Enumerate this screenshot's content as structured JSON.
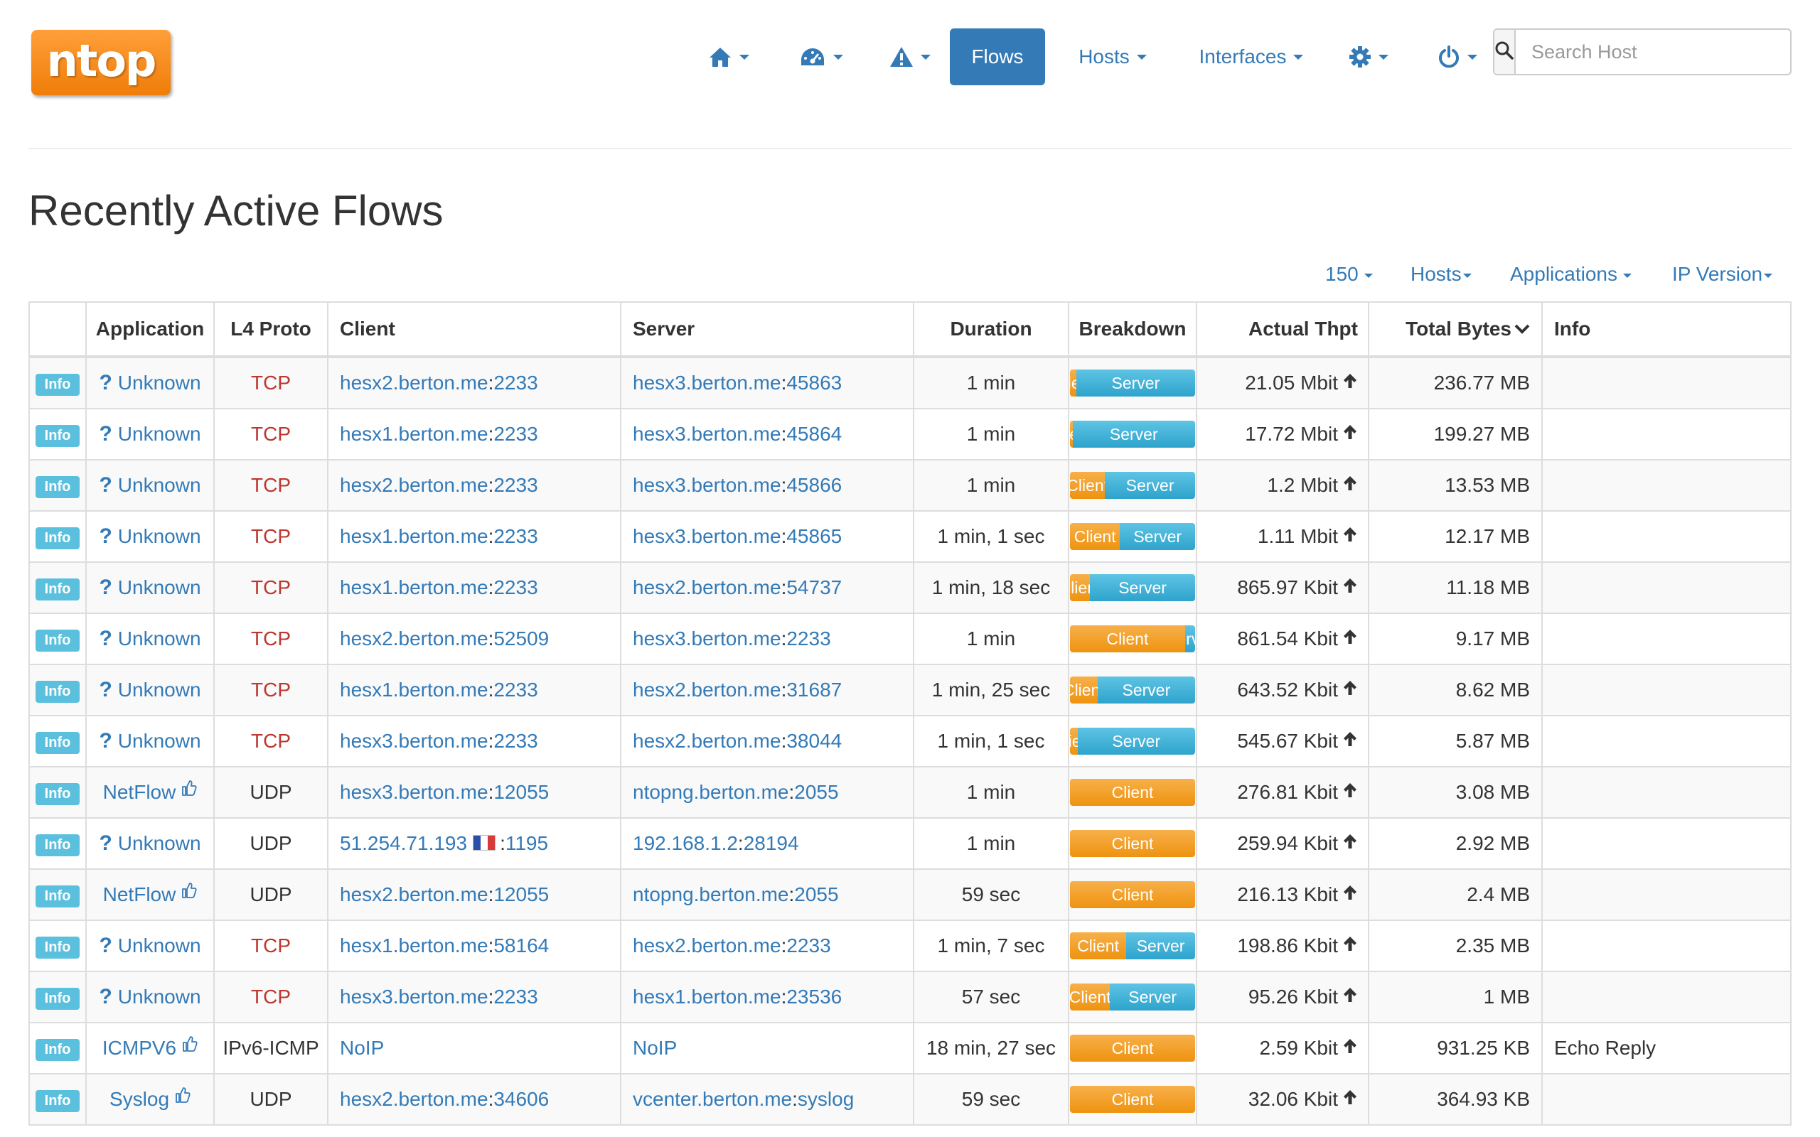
{
  "header": {
    "logo_text": "ntop",
    "nav": [
      {
        "icon": "home-icon"
      },
      {
        "icon": "dashboard-icon"
      },
      {
        "icon": "alert-icon"
      },
      {
        "label": "Flows",
        "active": true
      },
      {
        "label": "Hosts"
      },
      {
        "label": "Interfaces"
      },
      {
        "icon": "gear-icon"
      },
      {
        "icon": "power-icon"
      }
    ],
    "search_placeholder": "Search Host",
    "search_icon": "search-icon"
  },
  "page_title": "Recently Active Flows",
  "filters": {
    "rows_per_page": "150",
    "hosts": "Hosts",
    "applications": "Applications",
    "ip_version": "IP Version"
  },
  "table": {
    "columns": {
      "info": "",
      "application": "Application",
      "l4_proto": "L4 Proto",
      "client": "Client",
      "server": "Server",
      "duration": "Duration",
      "breakdown": "Breakdown",
      "actual_thpt": "Actual Thpt",
      "total_bytes": "Total Bytes",
      "info_text": "Info"
    },
    "info_button_label": "Info",
    "breakdown_client_label": "Client",
    "breakdown_server_label": "Server",
    "rows": [
      {
        "app": "Unknown",
        "app_icon": "question-icon",
        "l4": "TCP",
        "client_host": "hesx2.berton.me",
        "client_port": "2233",
        "server_host": "hesx3.berton.me",
        "server_port": "45863",
        "duration": "1 min",
        "client_pct": 5,
        "thpt": "21.05 Mbit",
        "bytes": "236.77 MB",
        "info": ""
      },
      {
        "app": "Unknown",
        "app_icon": "question-icon",
        "l4": "TCP",
        "client_host": "hesx1.berton.me",
        "client_port": "2233",
        "server_host": "hesx3.berton.me",
        "server_port": "45864",
        "duration": "1 min",
        "client_pct": 2,
        "thpt": "17.72 Mbit",
        "bytes": "199.27 MB",
        "info": ""
      },
      {
        "app": "Unknown",
        "app_icon": "question-icon",
        "l4": "TCP",
        "client_host": "hesx2.berton.me",
        "client_port": "2233",
        "server_host": "hesx3.berton.me",
        "server_port": "45866",
        "duration": "1 min",
        "client_pct": 28,
        "thpt": "1.2 Mbit",
        "bytes": "13.53 MB",
        "info": ""
      },
      {
        "app": "Unknown",
        "app_icon": "question-icon",
        "l4": "TCP",
        "client_host": "hesx1.berton.me",
        "client_port": "2233",
        "server_host": "hesx3.berton.me",
        "server_port": "45865",
        "duration": "1 min, 1 sec",
        "client_pct": 40,
        "thpt": "1.11 Mbit",
        "bytes": "12.17 MB",
        "info": ""
      },
      {
        "app": "Unknown",
        "app_icon": "question-icon",
        "l4": "TCP",
        "client_host": "hesx1.berton.me",
        "client_port": "2233",
        "server_host": "hesx2.berton.me",
        "server_port": "54737",
        "duration": "1 min, 18 sec",
        "client_pct": 16,
        "thpt": "865.97 Kbit",
        "bytes": "11.18 MB",
        "info": ""
      },
      {
        "app": "Unknown",
        "app_icon": "question-icon",
        "l4": "TCP",
        "client_host": "hesx2.berton.me",
        "client_port": "52509",
        "server_host": "hesx3.berton.me",
        "server_port": "2233",
        "duration": "1 min",
        "client_pct": 92,
        "thpt": "861.54 Kbit",
        "bytes": "9.17 MB",
        "info": ""
      },
      {
        "app": "Unknown",
        "app_icon": "question-icon",
        "l4": "TCP",
        "client_host": "hesx1.berton.me",
        "client_port": "2233",
        "server_host": "hesx2.berton.me",
        "server_port": "31687",
        "duration": "1 min, 25 sec",
        "client_pct": 22,
        "thpt": "643.52 Kbit",
        "bytes": "8.62 MB",
        "info": ""
      },
      {
        "app": "Unknown",
        "app_icon": "question-icon",
        "l4": "TCP",
        "client_host": "hesx3.berton.me",
        "client_port": "2233",
        "server_host": "hesx2.berton.me",
        "server_port": "38044",
        "duration": "1 min, 1 sec",
        "client_pct": 6,
        "thpt": "545.67 Kbit",
        "bytes": "5.87 MB",
        "info": ""
      },
      {
        "app": "NetFlow",
        "app_icon": "thumbs-up-icon",
        "l4": "UDP",
        "client_host": "hesx3.berton.me",
        "client_port": "12055",
        "server_host": "ntopng.berton.me",
        "server_port": "2055",
        "duration": "1 min",
        "client_pct": 100,
        "thpt": "276.81 Kbit",
        "bytes": "3.08 MB",
        "info": ""
      },
      {
        "app": "Unknown",
        "app_icon": "question-icon",
        "l4": "UDP",
        "client_host": "51.254.71.193",
        "client_flag": "france-flag-icon",
        "client_port": "1195",
        "server_host": "192.168.1.2",
        "server_port": "28194",
        "duration": "1 min",
        "client_pct": 100,
        "thpt": "259.94 Kbit",
        "bytes": "2.92 MB",
        "info": ""
      },
      {
        "app": "NetFlow",
        "app_icon": "thumbs-up-icon",
        "l4": "UDP",
        "client_host": "hesx2.berton.me",
        "client_port": "12055",
        "server_host": "ntopng.berton.me",
        "server_port": "2055",
        "duration": "59 sec",
        "client_pct": 100,
        "thpt": "216.13 Kbit",
        "bytes": "2.4 MB",
        "info": ""
      },
      {
        "app": "Unknown",
        "app_icon": "question-icon",
        "l4": "TCP",
        "client_host": "hesx1.berton.me",
        "client_port": "58164",
        "server_host": "hesx2.berton.me",
        "server_port": "2233",
        "duration": "1 min, 7 sec",
        "client_pct": 45,
        "thpt": "198.86 Kbit",
        "bytes": "2.35 MB",
        "info": ""
      },
      {
        "app": "Unknown",
        "app_icon": "question-icon",
        "l4": "TCP",
        "client_host": "hesx3.berton.me",
        "client_port": "2233",
        "server_host": "hesx1.berton.me",
        "server_port": "23536",
        "duration": "57 sec",
        "client_pct": 32,
        "thpt": "95.26 Kbit",
        "bytes": "1 MB",
        "info": ""
      },
      {
        "app": "ICMPV6",
        "app_icon": "thumbs-up-icon",
        "l4": "IPv6-ICMP",
        "client_host": "NoIP",
        "client_port": "",
        "server_host": "NoIP",
        "server_port": "",
        "duration": "18 min, 27 sec",
        "client_pct": 100,
        "thpt": "2.59 Kbit",
        "bytes": "931.25 KB",
        "info": "Echo Reply"
      },
      {
        "app": "Syslog",
        "app_icon": "thumbs-up-icon",
        "l4": "UDP",
        "client_host": "hesx2.berton.me",
        "client_port": "34606",
        "server_host": "vcenter.berton.me",
        "server_port": "syslog",
        "duration": "59 sec",
        "client_pct": 100,
        "thpt": "32.06 Kbit",
        "bytes": "364.93 KB",
        "info": ""
      }
    ]
  },
  "colors": {
    "link": "#337ab7",
    "tcp": "#bd362f",
    "info_button": "#5bc0de",
    "client_bar": "#f0a030",
    "server_bar": "#3fb1d8",
    "logo": "#f58a1f"
  }
}
